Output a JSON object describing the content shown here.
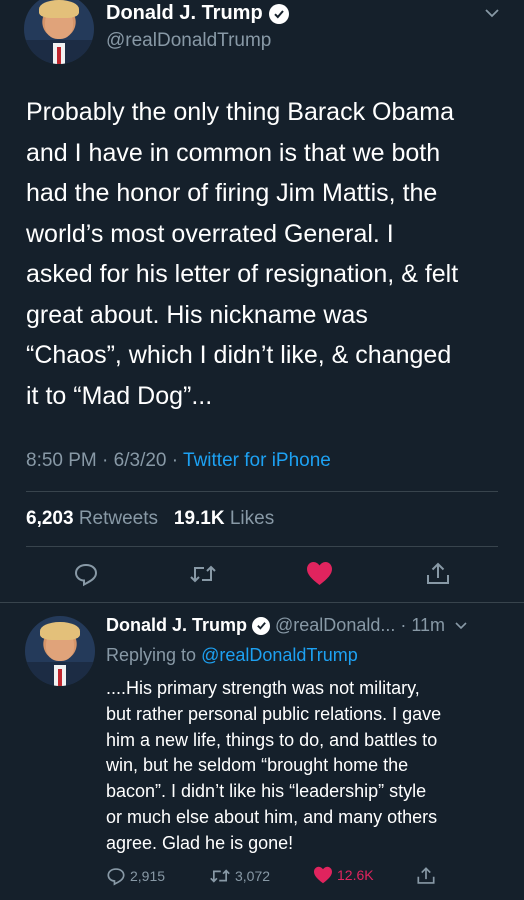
{
  "main_tweet": {
    "display_name": "Donald J. Trump",
    "handle": "@realDonaldTrump",
    "text": "Probably the only thing Barack Obama\nand I have in common is that we both\nhad the honor of firing Jim Mattis, the\nworld’s most overrated General. I\nasked for his letter of resignation, & felt\ngreat about. His nickname was\n“Chaos”, which I didn’t like, & changed\nit to “Mad Dog”...",
    "time": "8:50 PM",
    "date": "6/3/20",
    "source": "Twitter for iPhone",
    "retweets_count": "6,203",
    "retweets_label": "Retweets",
    "likes_count": "19.1K",
    "likes_label": "Likes",
    "icons": {
      "verified": "verified-badge-icon",
      "chevron": "chevron-down-icon",
      "reply": "reply-icon",
      "retweet": "retweet-icon",
      "like": "heart-icon",
      "share": "share-icon"
    }
  },
  "reply_tweet": {
    "display_name": "Donald J. Trump",
    "handle": "@realDonald...",
    "time": "11m",
    "replying_label": "Replying to",
    "replying_to": "@realDonaldTrump",
    "text": "....His primary strength was not military,\nbut rather personal public relations. I gave\nhim a new life, things to do, and battles to\nwin, but he seldom “brought home the\nbacon”. I didn’t like his “leadership” style\nor much else about him, and many others\nagree. Glad he is gone!",
    "reply_count": "2,915",
    "retweet_count": "3,072",
    "like_count": "12.6K"
  },
  "colors": {
    "background": "#15202b",
    "secondary_text": "#8899a6",
    "accent": "#1da1f2",
    "like": "#e0245e",
    "divider": "#38444d"
  }
}
